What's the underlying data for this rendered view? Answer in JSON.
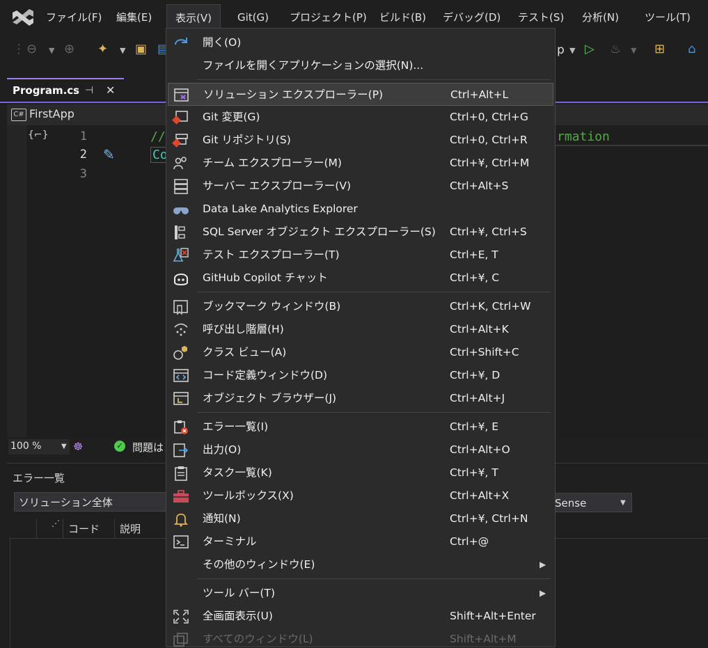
{
  "menubar": {
    "items": [
      "ファイル(F)",
      "編集(E)",
      "表示(V)",
      "Git(G)",
      "プロジェクト(P)",
      "ビルド(B)",
      "デバッグ(D)",
      "テスト(S)",
      "分析(N)",
      "ツール(T)"
    ]
  },
  "toolbar": {
    "run_target_fragment": "p"
  },
  "editor": {
    "tab_title": "Program.cs",
    "pin_glyph": "⊣",
    "close_glyph": "✕",
    "nav_project": "FirstApp",
    "nav_lang": "C#",
    "line_numbers": [
      "1",
      "2",
      "3"
    ],
    "line1_comment_prefix": "//",
    "line1_comment_suffix": "rmation",
    "line2_code_prefix": "Co"
  },
  "statusbar": {
    "zoom": "100 %",
    "issues_fragment": "問題は"
  },
  "error_list": {
    "title": "エラー一覧",
    "scope": "ソリューション全体",
    "source_fragment": "Sense",
    "columns": [
      "コード",
      "説明"
    ]
  },
  "view_menu": {
    "groups": [
      [
        {
          "icon": "redo-icon",
          "label": "開く(O)",
          "shortcut": ""
        },
        {
          "icon": "",
          "label": "ファイルを開くアプリケーションの選択(N)...",
          "shortcut": ""
        }
      ],
      [
        {
          "icon": "solution-explorer-icon",
          "label": "ソリューション エクスプローラー(P)",
          "shortcut": "Ctrl+Alt+L",
          "highlighted": true
        },
        {
          "icon": "git-changes-icon",
          "label": "Git 変更(G)",
          "shortcut": "Ctrl+0, Ctrl+G"
        },
        {
          "icon": "git-repository-icon",
          "label": "Git リポジトリ(S)",
          "shortcut": "Ctrl+0, Ctrl+R"
        },
        {
          "icon": "team-explorer-icon",
          "label": "チーム エクスプローラー(M)",
          "shortcut": "Ctrl+¥, Ctrl+M"
        },
        {
          "icon": "server-explorer-icon",
          "label": "サーバー エクスプローラー(V)",
          "shortcut": "Ctrl+Alt+S"
        },
        {
          "icon": "binoculars-icon",
          "label": "Data Lake Analytics Explorer",
          "shortcut": ""
        },
        {
          "icon": "sql-object-explorer-icon",
          "label": "SQL Server オブジェクト エクスプローラー(S)",
          "shortcut": "Ctrl+¥, Ctrl+S"
        },
        {
          "icon": "test-explorer-icon",
          "label": "テスト エクスプローラー(T)",
          "shortcut": "Ctrl+E, T"
        },
        {
          "icon": "copilot-icon",
          "label": "GitHub Copilot チャット",
          "shortcut": "Ctrl+¥, C"
        }
      ],
      [
        {
          "icon": "bookmark-window-icon",
          "label": "ブックマーク ウィンドウ(B)",
          "shortcut": "Ctrl+K, Ctrl+W"
        },
        {
          "icon": "call-hierarchy-icon",
          "label": "呼び出し階層(H)",
          "shortcut": "Ctrl+Alt+K"
        },
        {
          "icon": "class-view-icon",
          "label": "クラス ビュー(A)",
          "shortcut": "Ctrl+Shift+C"
        },
        {
          "icon": "code-definition-icon",
          "label": "コード定義ウィンドウ(D)",
          "shortcut": "Ctrl+¥, D"
        },
        {
          "icon": "object-browser-icon",
          "label": "オブジェクト ブラウザー(J)",
          "shortcut": "Ctrl+Alt+J"
        }
      ],
      [
        {
          "icon": "error-list-icon",
          "label": "エラー一覧(I)",
          "shortcut": "Ctrl+¥, E"
        },
        {
          "icon": "output-icon",
          "label": "出力(O)",
          "shortcut": "Ctrl+Alt+O"
        },
        {
          "icon": "task-list-icon",
          "label": "タスク一覧(K)",
          "shortcut": "Ctrl+¥, T"
        },
        {
          "icon": "toolbox-icon",
          "label": "ツールボックス(X)",
          "shortcut": "Ctrl+Alt+X"
        },
        {
          "icon": "bell-icon",
          "label": "通知(N)",
          "shortcut": "Ctrl+¥, Ctrl+N"
        },
        {
          "icon": "terminal-icon",
          "label": "ターミナル",
          "shortcut": "Ctrl+@"
        },
        {
          "icon": "",
          "label": "その他のウィンドウ(E)",
          "shortcut": "",
          "submenu": true
        }
      ],
      [
        {
          "icon": "",
          "label": "ツール バー(T)",
          "shortcut": "",
          "submenu": true
        },
        {
          "icon": "fullscreen-icon",
          "label": "全画面表示(U)",
          "shortcut": "Shift+Alt+Enter"
        },
        {
          "icon": "all-windows-icon",
          "label": "すべてのウィンドウ(L)",
          "shortcut": "Shift+Alt+M",
          "disabled": true
        }
      ]
    ]
  },
  "colors": {
    "accent": "#7a64d8",
    "comment_green": "#57a64a",
    "code_teal": "#4ec9b0",
    "menu_bg": "#2b2b2b",
    "highlight": "#3d3d3d"
  }
}
